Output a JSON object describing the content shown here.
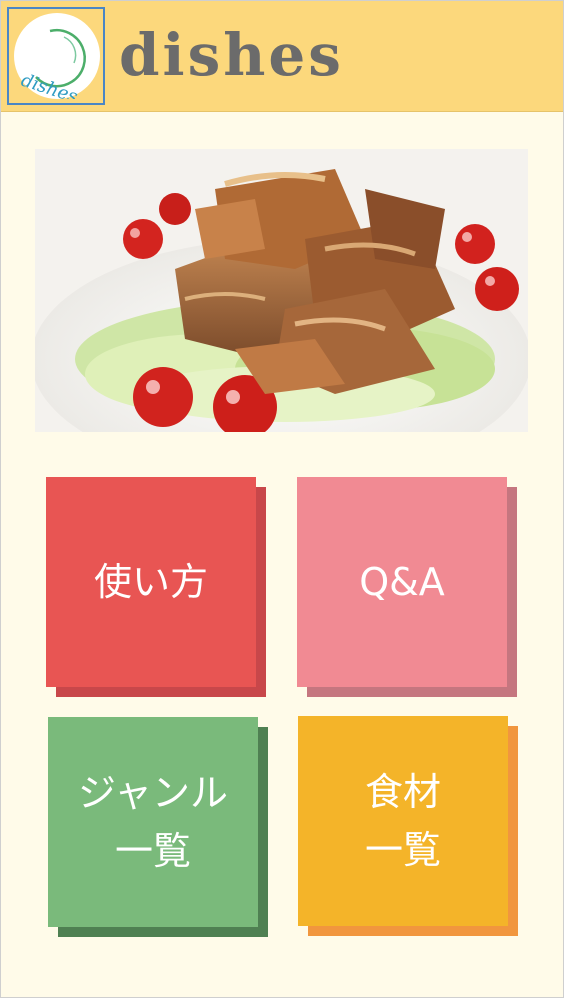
{
  "header": {
    "logo_text": "dishes",
    "app_title": "dishes",
    "colors": {
      "background": "#fcd87c",
      "title": "#6b6b6b",
      "logo_border": "#4a86c5"
    }
  },
  "hero": {
    "description": "pork and vegetable dish photo",
    "icon": "food-photo"
  },
  "menu": {
    "tiles": [
      {
        "label": "使い方",
        "color": "#e85553"
      },
      {
        "label": "Q&A",
        "color": "#f18a93"
      },
      {
        "label": "ジャンル\n一覧",
        "color": "#7aba7b"
      },
      {
        "label": "食材\n一覧",
        "color": "#f4b429"
      }
    ]
  },
  "colors": {
    "page_background": "#fffbe9"
  }
}
